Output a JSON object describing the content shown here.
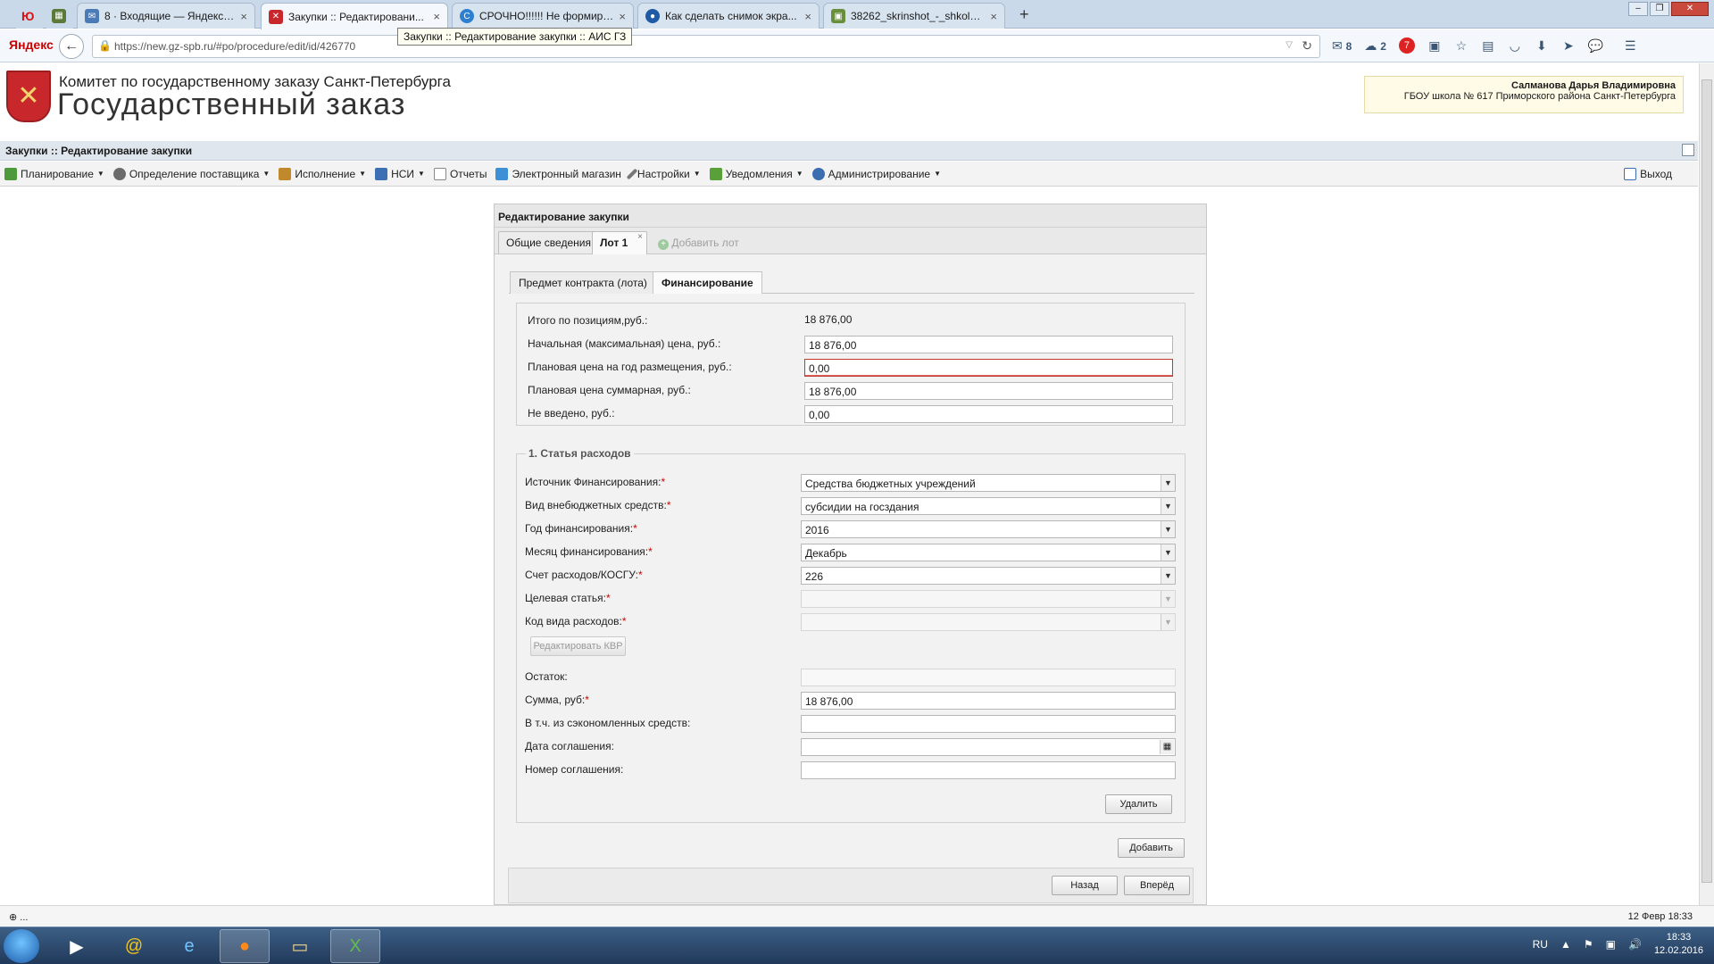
{
  "browser": {
    "tabs": [
      {
        "title": "8 · Входящие — Яндекс.П...",
        "active": false
      },
      {
        "title": "Закупки :: Редактировани...",
        "active": true
      },
      {
        "title": "СРОЧНО!!!!!! Не формиру...",
        "active": false
      },
      {
        "title": "Как сделать снимок экра...",
        "active": false
      },
      {
        "title": "38262_skrinshot_-_shkola_6...",
        "active": false
      }
    ],
    "pinned_tab_1": "Ю",
    "new_tab": "+",
    "brand": "Яндекс",
    "url": "https://new.gz-spb.ru/#po/procedure/edit/id/426770",
    "tooltip": "Закупки :: Редактирование закупки :: АИС ГЗ",
    "mail_count": "8",
    "cloud_count": "2",
    "badge_count": "7"
  },
  "header": {
    "org_line": "Комитет по государственному заказу Санкт-Петербурга",
    "system_name": "Государственный заказ",
    "user_name": "Салманова Дарья Владимировна",
    "user_org": "ГБОУ школа № 617 Приморского района Санкт-Петербурга"
  },
  "breadcrumb": "Закупки :: Редактирование закупки",
  "menu": {
    "items": [
      "Планирование",
      "Определение поставщика",
      "Исполнение",
      "НСИ",
      "Отчеты",
      "Электронный магазин",
      "Настройки",
      "Уведомления",
      "Администрирование"
    ],
    "exit": "Выход"
  },
  "panel": {
    "title": "Редактирование закупки",
    "tabs": [
      "Общие сведения",
      "Лот 1",
      "Добавить лот"
    ],
    "subtabs": [
      "Предмет контракта (лота)",
      "Финансирование"
    ],
    "summary": {
      "total_label": "Итого по позициям,руб.:",
      "total_value": "18 876,00",
      "initial_label": "Начальная (максимальная) цена, руб.:",
      "initial_value": "18 876,00",
      "plan_year_label": "Плановая цена на год размещения, руб.:",
      "plan_year_value": "0,00",
      "plan_total_label": "Плановая цена суммарная, руб.:",
      "plan_total_value": "18 876,00",
      "not_entered_label": "Не введено, руб.:",
      "not_entered_value": "0,00"
    },
    "expense": {
      "legend": "1. Статья расходов",
      "source_label": "Источник Финансирования:",
      "source_value": "Средства бюджетных учреждений",
      "extra_label": "Вид внебюджетных средств:",
      "extra_value": "субсидии на госздания",
      "year_label": "Год финансирования:",
      "year_value": "2016",
      "month_label": "Месяц финансирования:",
      "month_value": "Декабрь",
      "account_label": "Счет расходов/КОСГУ:",
      "account_value": "226",
      "target_label": "Целевая статья:",
      "target_value": "",
      "kvr_label": "Код вида расходов:",
      "kvr_value": "",
      "edit_kvr": "Редактировать КВР",
      "rest_label": "Остаток:",
      "rest_value": "",
      "sum_label": "Сумма, руб:",
      "sum_value": "18 876,00",
      "saved_label": "В т.ч. из сэкономленных средств:",
      "saved_value": "",
      "date_label": "Дата соглашения:",
      "date_value": "",
      "number_label": "Номер соглашения:",
      "number_value": "",
      "delete": "Удалить"
    },
    "add": "Добавить",
    "back": "Назад",
    "forward": "Вперёд"
  },
  "status": {
    "left": "⊕ ...",
    "right": "12 Февр 18:33"
  },
  "taskbar": {
    "lang": "RU",
    "time": "18:33",
    "date": "12.02.2016"
  }
}
